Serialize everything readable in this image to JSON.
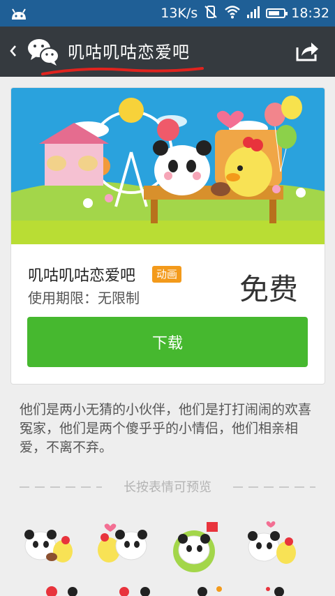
{
  "status_bar": {
    "speed": "13K/s",
    "time": "18:32",
    "battery_level": 0.8
  },
  "header": {
    "title": "叽咕叽咕恋爱吧"
  },
  "product": {
    "name": "叽咕叽咕恋爱吧",
    "badge": "动画",
    "validity": "使用期限：无限制",
    "price": "免费",
    "download_label": "下载"
  },
  "description": "他们是两小无猜的小伙伴，他们是打打闹闹的欢喜冤家，他们是两个傻乎乎的小情侣，他们相亲相爱，不离不弃。",
  "preview_hint": "长按表情可预览",
  "colors": {
    "status_bar": "#1f5f96",
    "header": "#353a3f",
    "download": "#46b82f",
    "badge": "#f39a1b"
  }
}
